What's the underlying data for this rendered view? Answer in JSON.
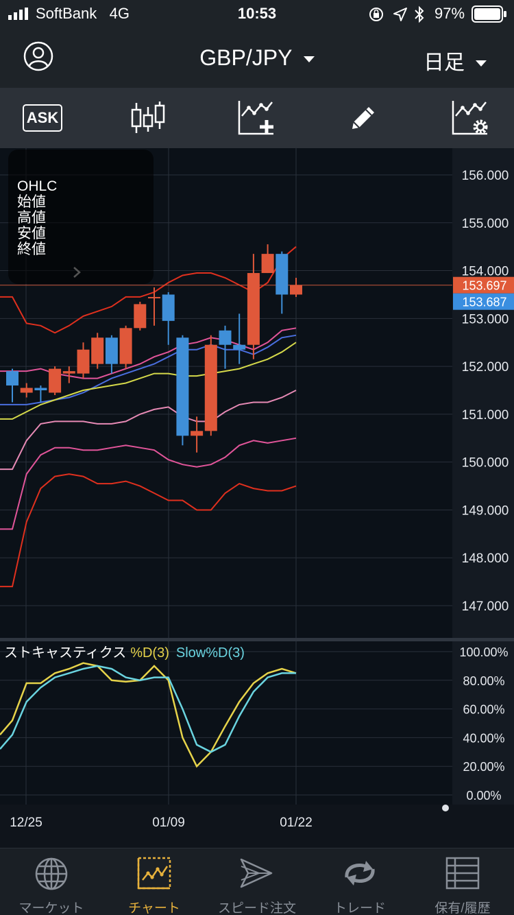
{
  "status_bar": {
    "carrier": "SoftBank   4G",
    "time": "10:53",
    "battery_percent": "97%"
  },
  "header": {
    "pair": "GBP/JPY",
    "period": "日足"
  },
  "toolbar": {
    "ask_label": "ASK"
  },
  "ohlc_panel": {
    "lines": [
      "OHLC",
      "始値",
      "高値",
      "安値",
      "終値"
    ]
  },
  "price_axis": {
    "ticks": [
      "156.000",
      "155.000",
      "154.000",
      "153.000",
      "152.000",
      "151.000",
      "150.000",
      "149.000",
      "148.000",
      "147.000"
    ],
    "ask_price": "153.697",
    "bid_price": "153.687"
  },
  "stochastic": {
    "title": "ストキャスティクス",
    "d_label": "%D(3)",
    "slow_label": "Slow%D(3)",
    "ticks": [
      "100.00%",
      "80.00%",
      "60.00%",
      "40.00%",
      "20.00%",
      "0.00%"
    ]
  },
  "date_axis": {
    "labels": [
      "12/25",
      "01/09",
      "01/22"
    ]
  },
  "tabs": [
    {
      "label": "マーケット",
      "icon": "globe-icon"
    },
    {
      "label": "チャート",
      "icon": "chart-icon"
    },
    {
      "label": "スピード注文",
      "icon": "speed-order-icon"
    },
    {
      "label": "トレード",
      "icon": "trade-icon"
    },
    {
      "label": "保有/履歴",
      "icon": "list-icon"
    }
  ],
  "colors": {
    "up_candle": "#e0583a",
    "down_candle": "#3f8fd8",
    "bollinger_outer": "#e0301e",
    "bollinger_mid": "#e2559a",
    "bollinger_inner": "#e78ab5",
    "ma_blue": "#4a6fe0",
    "ma_yellow": "#d5d94a",
    "stoch_d": "#e6d34a",
    "stoch_slow": "#6ad4e0",
    "active_tab": "#e8b23c"
  },
  "chart_data": {
    "type": "candlestick",
    "dates_shown": [
      "12/25",
      "01/09",
      "01/22"
    ],
    "candles": [
      {
        "open": 151.9,
        "high": 151.95,
        "close": 151.6,
        "low": 151.25
      },
      {
        "open": 151.45,
        "high": 151.65,
        "close": 151.55,
        "low": 151.35
      },
      {
        "open": 151.55,
        "high": 151.6,
        "close": 151.5,
        "low": 151.25
      },
      {
        "open": 151.45,
        "high": 152.0,
        "close": 151.95,
        "low": 151.4
      },
      {
        "open": 151.85,
        "high": 152.0,
        "close": 151.9,
        "low": 151.65
      },
      {
        "open": 151.85,
        "high": 152.5,
        "close": 152.35,
        "low": 151.75
      },
      {
        "open": 152.05,
        "high": 152.7,
        "close": 152.6,
        "low": 151.95
      },
      {
        "open": 152.6,
        "high": 152.65,
        "close": 152.05,
        "low": 151.85
      },
      {
        "open": 152.05,
        "high": 152.85,
        "close": 152.8,
        "low": 151.95
      },
      {
        "open": 152.8,
        "high": 153.35,
        "close": 153.3,
        "low": 152.75
      },
      {
        "open": 153.45,
        "high": 153.65,
        "close": 153.45,
        "low": 152.85
      },
      {
        "open": 153.5,
        "high": 153.55,
        "close": 152.95,
        "low": 152.45
      },
      {
        "open": 152.6,
        "high": 152.65,
        "close": 150.55,
        "low": 150.35
      },
      {
        "open": 150.55,
        "high": 150.95,
        "close": 150.65,
        "low": 150.2
      },
      {
        "open": 150.65,
        "high": 152.65,
        "close": 152.45,
        "low": 150.55
      },
      {
        "open": 152.75,
        "high": 152.85,
        "close": 152.45,
        "low": 151.95
      },
      {
        "open": 152.45,
        "high": 153.1,
        "close": 152.35,
        "low": 152.05
      },
      {
        "open": 152.45,
        "high": 154.35,
        "close": 153.95,
        "low": 152.15
      },
      {
        "open": 153.95,
        "high": 154.55,
        "close": 154.35,
        "low": 153.95
      },
      {
        "open": 154.35,
        "high": 154.4,
        "close": 153.5,
        "low": 153.1
      },
      {
        "open": 153.5,
        "high": 153.85,
        "close": 153.7,
        "low": 153.45
      }
    ],
    "current_ask": 153.697,
    "current_bid": 153.687,
    "ylim": [
      146.0,
      156.5
    ],
    "overlays": [
      {
        "values": [
          153.45,
          152.9,
          152.85,
          152.7,
          152.85,
          153.05,
          153.15,
          153.25,
          153.45,
          153.45,
          153.55,
          153.75,
          153.9,
          153.95,
          153.95,
          153.85,
          153.7,
          153.55,
          153.75,
          154.25,
          154.5
        ]
      },
      {
        "values": [
          151.9,
          151.9,
          151.95,
          151.85,
          151.8,
          151.75,
          151.75,
          151.85,
          151.95,
          152.05,
          152.2,
          152.3,
          152.45,
          152.5,
          152.6,
          152.55,
          152.45,
          152.35,
          152.5,
          152.75,
          152.8
        ]
      },
      {
        "values": [
          151.2,
          151.2,
          151.25,
          151.3,
          151.35,
          151.45,
          151.6,
          151.75,
          151.85,
          151.95,
          152.05,
          152.2,
          152.35,
          152.35,
          152.45,
          152.35,
          152.35,
          152.25,
          152.4,
          152.6,
          152.65
        ]
      },
      {
        "values": [
          150.9,
          151.05,
          151.2,
          151.3,
          151.4,
          151.5,
          151.55,
          151.6,
          151.65,
          151.75,
          151.85,
          151.85,
          151.8,
          151.8,
          151.85,
          151.9,
          151.95,
          152.05,
          152.15,
          152.3,
          152.5
        ]
      },
      {
        "values": [
          149.85,
          150.45,
          150.8,
          150.85,
          150.85,
          150.85,
          150.8,
          150.8,
          150.85,
          151.0,
          151.1,
          151.15,
          150.95,
          150.85,
          150.85,
          151.05,
          151.2,
          151.25,
          151.25,
          151.35,
          151.5
        ]
      },
      {
        "values": [
          148.6,
          149.75,
          150.15,
          150.3,
          150.3,
          150.25,
          150.25,
          150.3,
          150.35,
          150.3,
          150.25,
          150.05,
          149.95,
          149.9,
          149.95,
          150.1,
          150.35,
          150.45,
          150.4,
          150.45,
          150.5
        ]
      },
      {
        "values": [
          147.4,
          148.75,
          149.45,
          149.7,
          149.75,
          149.7,
          149.55,
          149.55,
          149.6,
          149.5,
          149.35,
          149.2,
          149.2,
          149.0,
          149.0,
          149.35,
          149.55,
          149.45,
          149.4,
          149.4,
          149.5
        ]
      }
    ],
    "stochastic": {
      "percent_d": [
        52,
        78,
        78,
        85,
        88,
        92,
        90,
        80,
        79,
        80,
        90,
        80,
        40,
        20,
        30,
        48,
        65,
        78,
        85,
        88,
        85
      ],
      "slow_percent_d": [
        42,
        65,
        75,
        82,
        85,
        88,
        90,
        88,
        82,
        80,
        82,
        82,
        60,
        35,
        30,
        35,
        55,
        72,
        82,
        85,
        85
      ],
      "ylim": [
        0,
        100
      ]
    }
  }
}
